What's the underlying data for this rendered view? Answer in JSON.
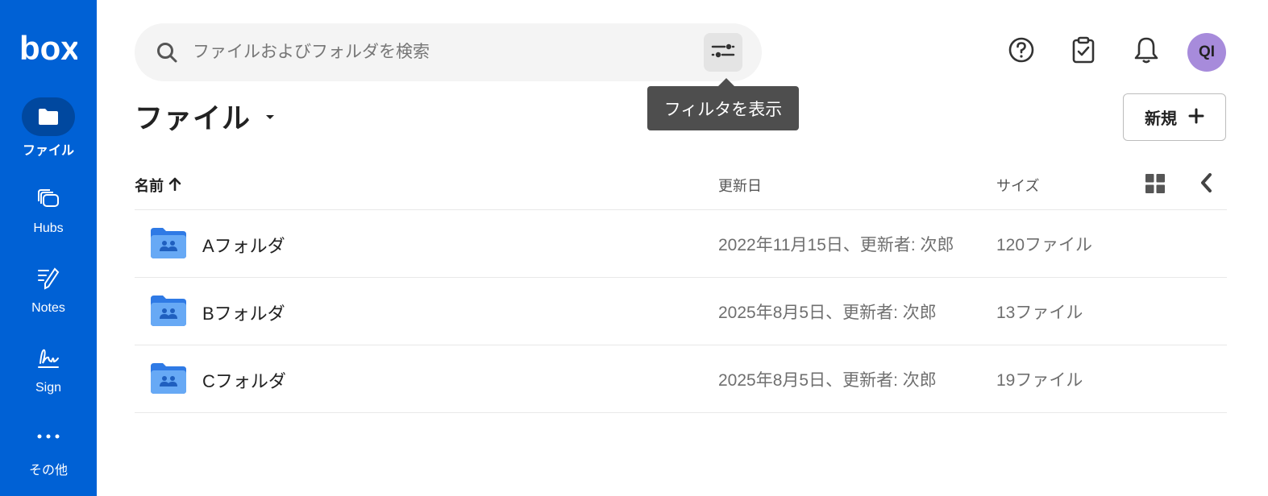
{
  "app": {
    "logo_text": "box",
    "brand_color": "#0061d5"
  },
  "sidebar": {
    "items": [
      {
        "label": "ファイル",
        "icon": "folder-icon",
        "active": true
      },
      {
        "label": "Hubs",
        "icon": "hubs-icon",
        "active": false
      },
      {
        "label": "Notes",
        "icon": "notes-icon",
        "active": false
      },
      {
        "label": "Sign",
        "icon": "sign-icon",
        "active": false
      },
      {
        "label": "その他",
        "icon": "more-icon",
        "active": false
      }
    ]
  },
  "search": {
    "placeholder": "ファイルおよびフォルダを検索",
    "value": "",
    "filter_icon": "filter-sliders-icon"
  },
  "tooltip": {
    "text": "フィルタを表示"
  },
  "header": {
    "help_icon": "help-icon",
    "tasks_icon": "clipboard-check-icon",
    "notifications_icon": "bell-icon",
    "avatar_initials": "QI",
    "avatar_color": "#a78bdb"
  },
  "page": {
    "title": "ファイル",
    "new_button_label": "新規"
  },
  "table": {
    "columns": {
      "name": "名前",
      "modified": "更新日",
      "size": "サイズ"
    },
    "sort": {
      "column": "name",
      "direction": "ascending"
    },
    "rows": [
      {
        "name": "Aフォルダ",
        "modified": "2022年11月15日、更新者: 次郎",
        "size": "120ファイル"
      },
      {
        "name": "Bフォルダ",
        "modified": "2025年8月5日、更新者: 次郎",
        "size": "13ファイル"
      },
      {
        "name": "Cフォルダ",
        "modified": "2025年8月5日、更新者: 次郎",
        "size": "19ファイル"
      }
    ]
  }
}
